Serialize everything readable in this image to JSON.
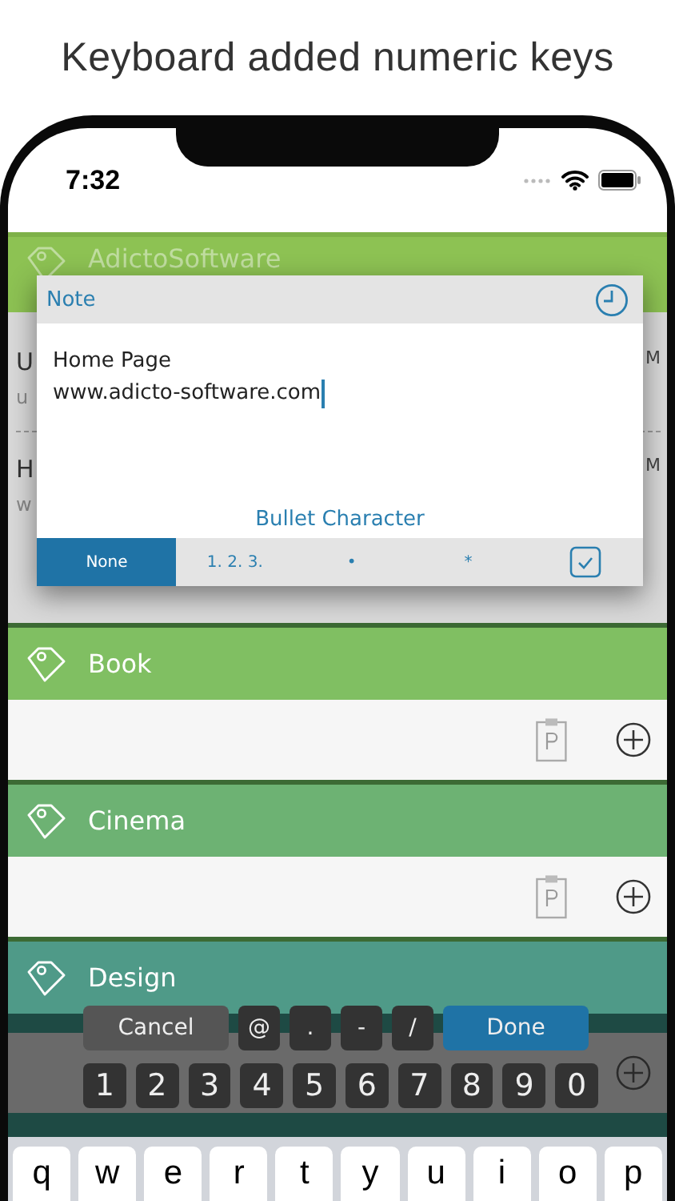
{
  "caption": "Keyboard added numeric keys",
  "status_bar": {
    "time": "7:32"
  },
  "categories": [
    {
      "name": "AdictoSoftware",
      "color": "#8dc253",
      "kind": "covered",
      "entries": [
        {
          "title": "U",
          "subtitle": "u",
          "time": "M"
        },
        {
          "title": "H",
          "subtitle": "w",
          "time": "M"
        }
      ]
    },
    {
      "name": "Book",
      "color": "#80bf62",
      "kind": "empty"
    },
    {
      "name": "Cinema",
      "color": "#6db273",
      "kind": "empty"
    },
    {
      "name": "Design",
      "color": "#4f9a88",
      "kind": "under-keys"
    }
  ],
  "note_popup": {
    "title": "Note",
    "lines": [
      "Home Page",
      "www.adicto-software.com"
    ],
    "section_label": "Bullet Character",
    "bullet_options": [
      {
        "label": "None",
        "selected": true
      },
      {
        "label": "1. 2. 3.",
        "selected": false
      },
      {
        "label": "•",
        "selected": false
      },
      {
        "label": "*",
        "selected": false
      }
    ]
  },
  "accessory_bar": {
    "cancel": "Cancel",
    "symbols": [
      "@",
      ".",
      "-",
      "/"
    ],
    "done": "Done",
    "digits": [
      "1",
      "2",
      "3",
      "4",
      "5",
      "6",
      "7",
      "8",
      "9",
      "0"
    ]
  },
  "keyboard": {
    "letters": [
      "q",
      "w",
      "e",
      "r",
      "t",
      "y",
      "u",
      "i",
      "o",
      "p"
    ]
  }
}
